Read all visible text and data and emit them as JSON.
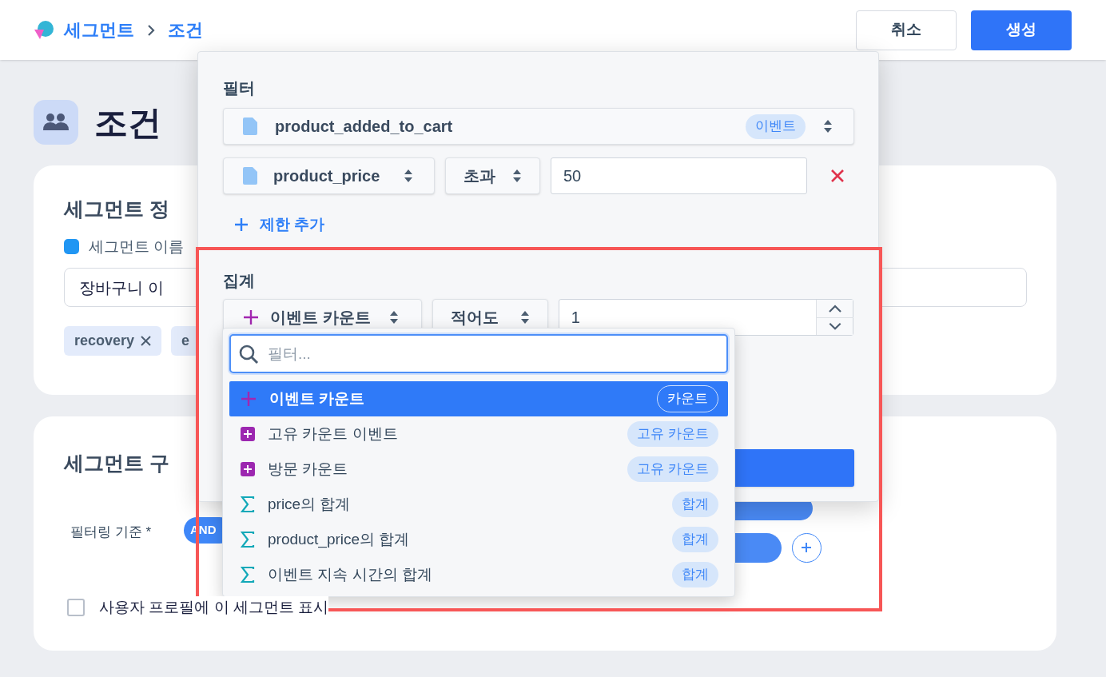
{
  "breadcrumb": [
    {
      "label": "세그먼트"
    },
    {
      "label": "조건"
    }
  ],
  "header_buttons": {
    "cancel": "취소",
    "create": "생성"
  },
  "page_title": "조건",
  "info_card": {
    "title": "세그먼트 정",
    "name_label": "세그먼트 이름",
    "name_value": "장바구니 이",
    "tags": [
      {
        "label": "recovery",
        "removable": true
      },
      {
        "label": "e",
        "removable": false
      }
    ]
  },
  "composition_card": {
    "title": "세그먼트 구",
    "filter_by_label": "필터링 기준 *",
    "operator": "AND",
    "show_in_profile": {
      "label": "사용자 프로필에 이 세그먼트 표시",
      "checked": false
    }
  },
  "popover": {
    "filter_title": "필터",
    "event": {
      "name": "product_added_to_cart",
      "badge": "이벤트"
    },
    "constraint": {
      "property": "product_price",
      "operator": "초과",
      "value": "50"
    },
    "add_constraint": "제한 추가",
    "aggregation_title": "집계",
    "aggregation": {
      "function": "이벤트 카운트",
      "comparator": "적어도",
      "value": "1"
    }
  },
  "dropdown": {
    "search_placeholder": "필터...",
    "options": [
      {
        "label": "이벤트 카운트",
        "badge": "카운트",
        "kind": "plus",
        "selected": true
      },
      {
        "label": "고유 카운트 이벤트",
        "badge": "고유 카운트",
        "kind": "plus-square",
        "selected": false
      },
      {
        "label": "방문 카운트",
        "badge": "고유 카운트",
        "kind": "plus-square",
        "selected": false
      },
      {
        "label": "price의 합계",
        "badge": "합계",
        "kind": "sigma",
        "selected": false
      },
      {
        "label": "product_price의 합계",
        "badge": "합계",
        "kind": "sigma",
        "selected": false
      },
      {
        "label": "이벤트 지속 시간의 합계",
        "badge": "합계",
        "kind": "sigma",
        "selected": false
      }
    ]
  }
}
